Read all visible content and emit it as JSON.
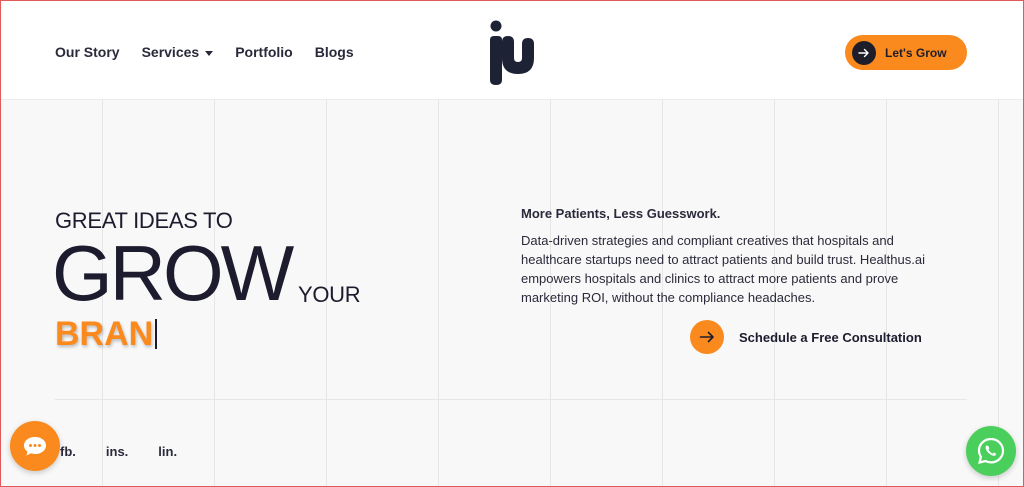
{
  "nav": {
    "items": [
      {
        "label": "Our Story",
        "has_dropdown": false
      },
      {
        "label": "Services",
        "has_dropdown": true
      },
      {
        "label": "Portfolio",
        "has_dropdown": false
      },
      {
        "label": "Blogs",
        "has_dropdown": false
      }
    ],
    "cta_label": "Let's Grow"
  },
  "hero": {
    "line1": "GREAT IDEAS TO",
    "line2": "GROW",
    "line3": "YOUR",
    "typed_text": "BRAN"
  },
  "intro": {
    "tagline": "More Patients, Less Guesswork.",
    "description": "Data-driven strategies and compliant creatives that hospitals and healthcare startups need to attract patients and build trust. Healthus.ai empowers hospitals and clinics to attract more patients and prove marketing ROI, without the compliance headaches.",
    "schedule_label": "Schedule a Free Consultation"
  },
  "socials": [
    "fb.",
    "ins.",
    "lin."
  ],
  "icons": {
    "cta": "arrow-right-icon",
    "schedule": "arrow-right-icon",
    "chat": "chat-bubble-icon",
    "whatsapp": "whatsapp-icon",
    "logo": "brand-logo"
  },
  "colors": {
    "accent": "#fb8a1e",
    "dark": "#1c1c2e",
    "logo": "#1e2235",
    "whatsapp": "#4bcf5c",
    "background": "#f8f8f8"
  }
}
